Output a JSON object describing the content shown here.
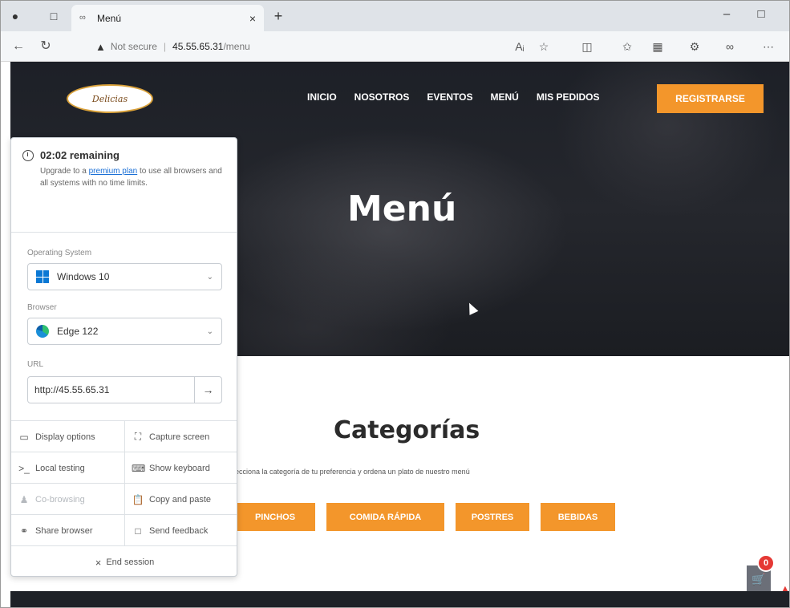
{
  "browser": {
    "tab_title": "Menú",
    "security_label": "Not secure",
    "url_host": "45.55.65.31",
    "url_path": "/menu"
  },
  "site": {
    "logo_text": "Delicias",
    "nav": [
      "INICIO",
      "NOSOTROS",
      "EVENTOS",
      "MENÚ",
      "MIS PEDIDOS"
    ],
    "register_label": "REGISTRARSE",
    "hero_title": "Menú",
    "categories_title": "Categorías",
    "categories_subtitle": "ecciona la categoría de tu preferencia y ordena un plato de nuestro menú",
    "category_buttons": [
      "PINCHOS",
      "COMIDA RÁPIDA",
      "POSTRES",
      "BEBIDAS"
    ],
    "cart_count": "0",
    "accent_color": "#f3962b"
  },
  "panel": {
    "timer": "02:02 remaining",
    "upgrade_prefix": "Upgrade to a ",
    "upgrade_link": "premium plan",
    "upgrade_suffix": " to use all browsers and all systems with no time limits.",
    "os_label": "Operating System",
    "os_value": "Windows 10",
    "browser_label": "Browser",
    "browser_value": "Edge 122",
    "url_label": "URL",
    "url_value": "http://45.55.65.31",
    "actions": [
      {
        "label": "Display options",
        "icon": "monitor-icon"
      },
      {
        "label": "Capture screen",
        "icon": "capture-icon"
      },
      {
        "label": "Local testing",
        "icon": "terminal-icon"
      },
      {
        "label": "Show keyboard",
        "icon": "keyboard-icon"
      },
      {
        "label": "Co-browsing",
        "icon": "users-icon"
      },
      {
        "label": "Copy and paste",
        "icon": "clipboard-icon"
      },
      {
        "label": "Share browser",
        "icon": "link-icon"
      },
      {
        "label": "Send feedback",
        "icon": "message-icon"
      }
    ],
    "end_session": "End session"
  }
}
